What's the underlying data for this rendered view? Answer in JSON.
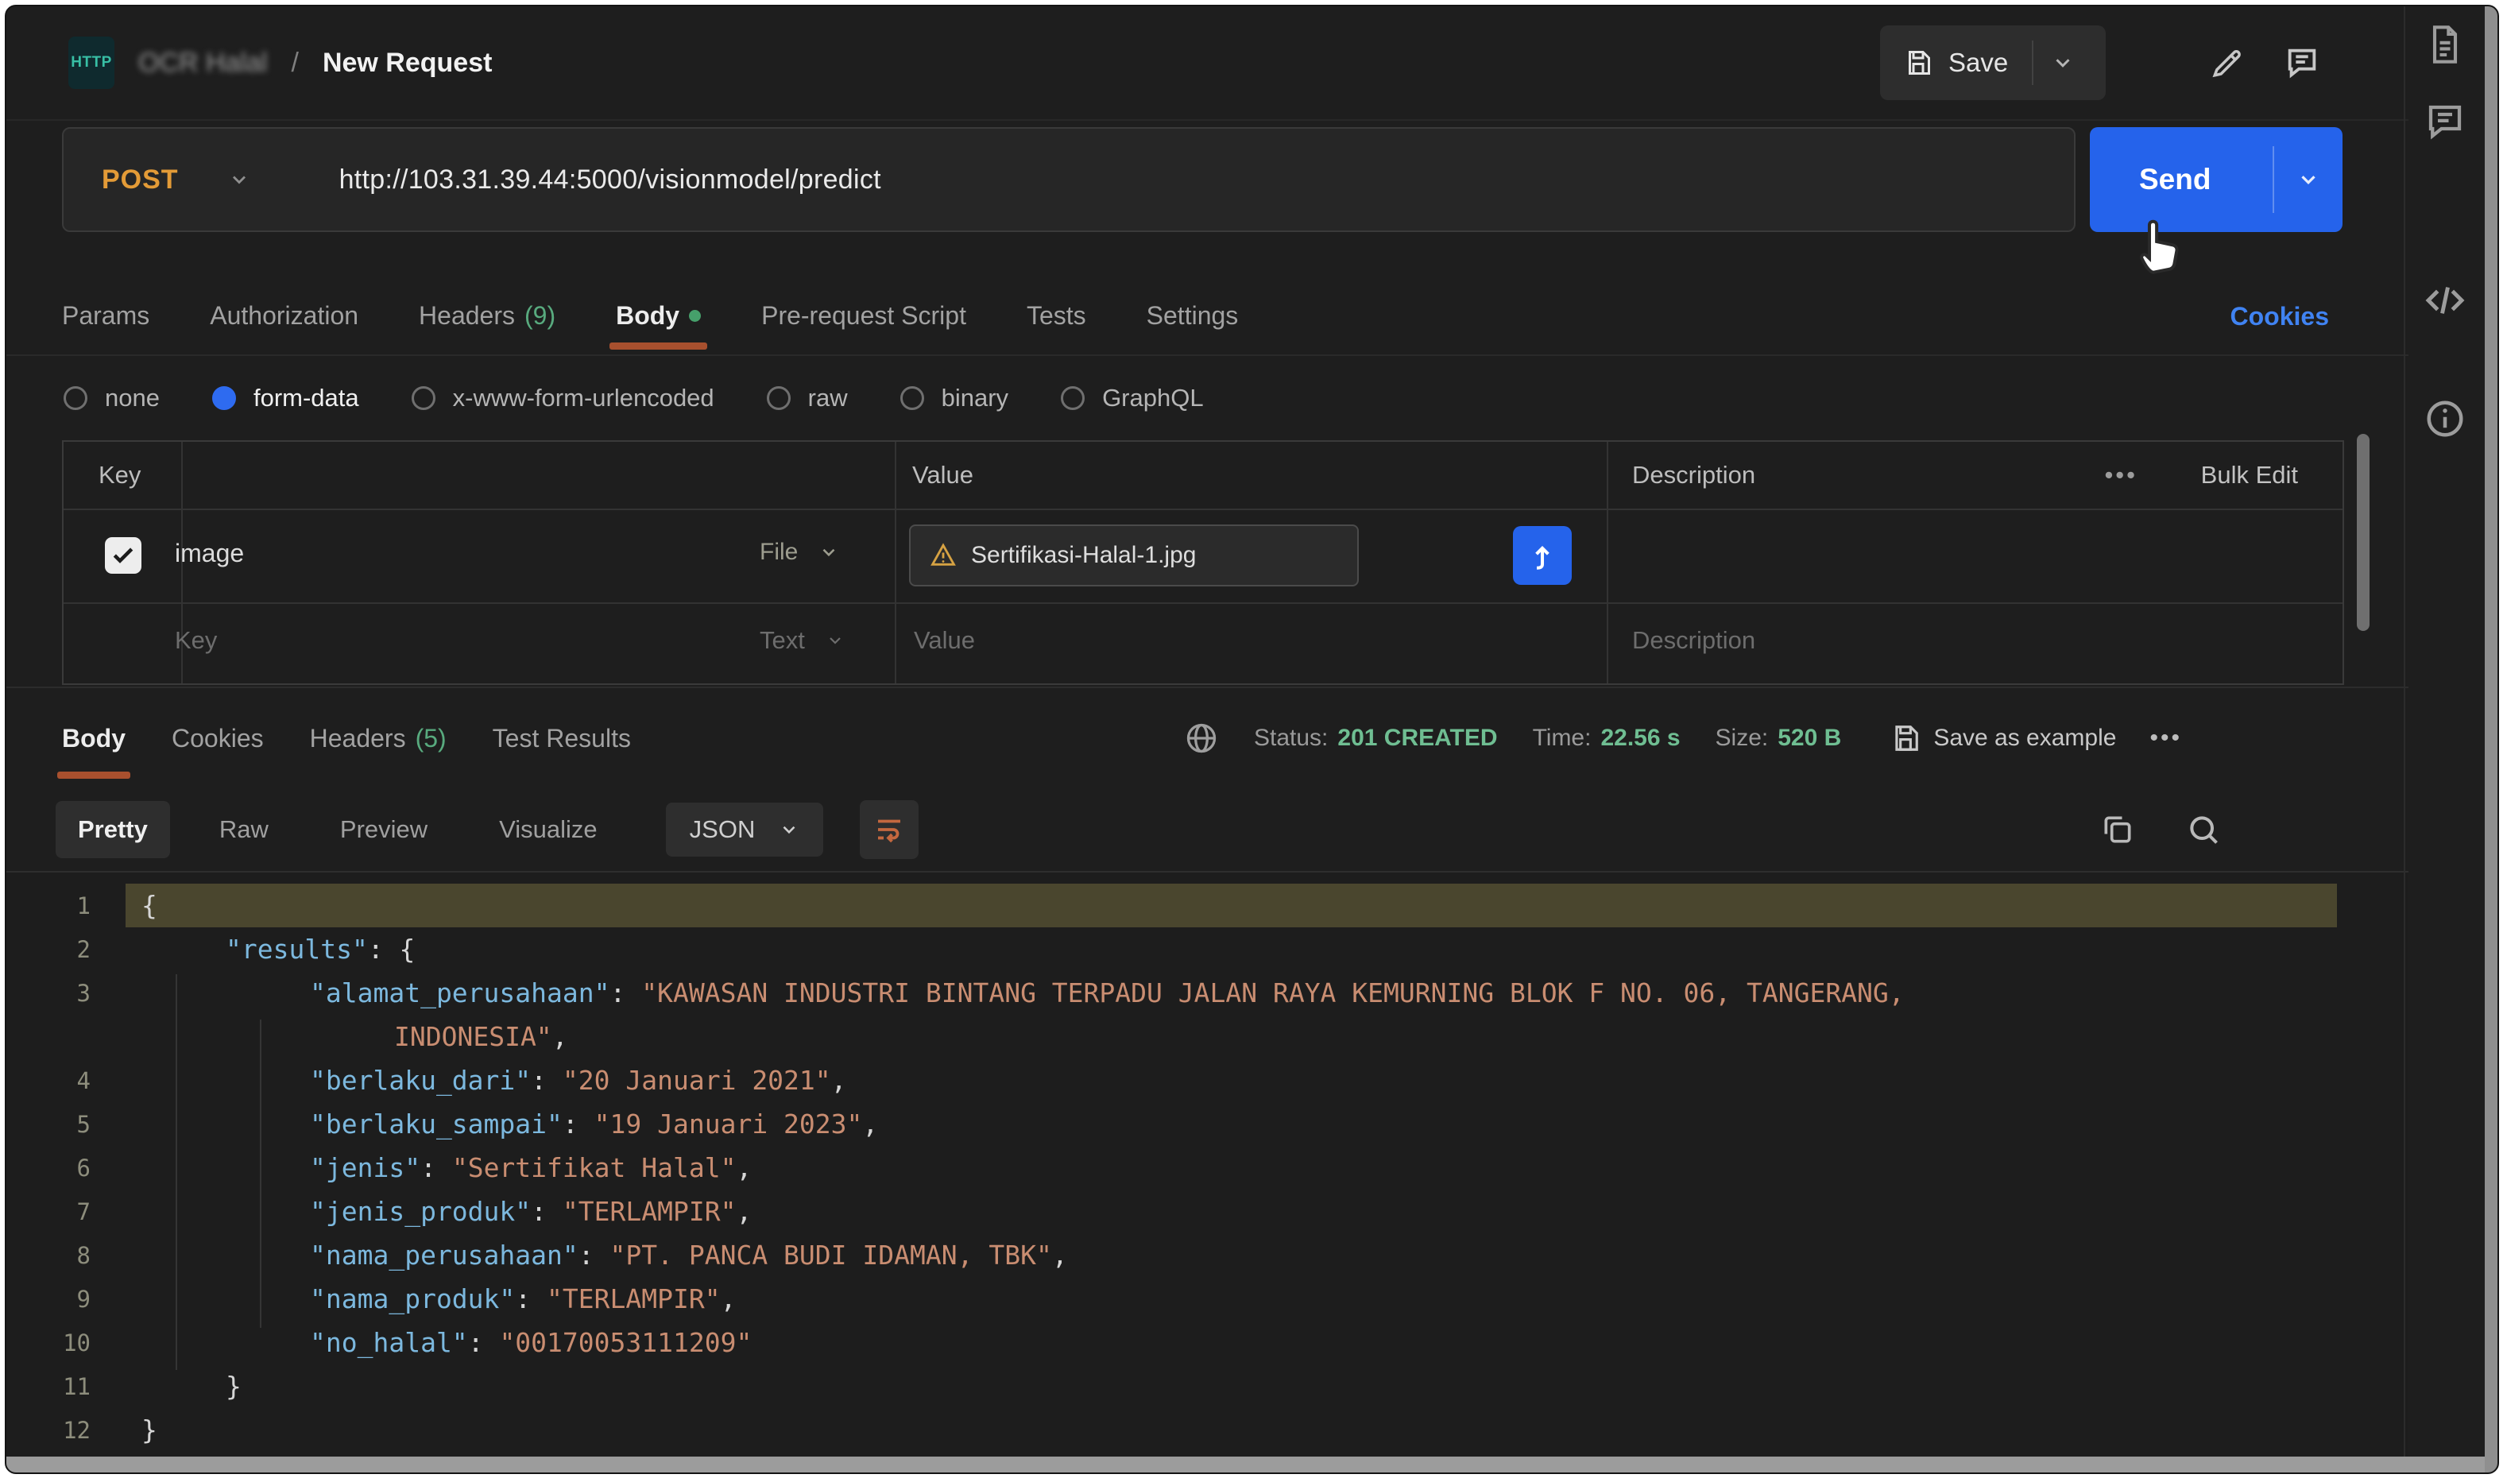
{
  "header": {
    "badge": "HTTP",
    "collection_name": "OCR Halal",
    "separator": "/",
    "request_name": "New Request",
    "save_label": "Save"
  },
  "request_bar": {
    "method": "POST",
    "url": "http://103.31.39.44:5000/visionmodel/predict",
    "send_label": "Send"
  },
  "request_tabs": {
    "items": [
      {
        "label": "Params"
      },
      {
        "label": "Authorization"
      },
      {
        "label": "Headers",
        "count": "(9)"
      },
      {
        "label": "Body",
        "active": true,
        "dot": true
      },
      {
        "label": "Pre-request Script"
      },
      {
        "label": "Tests"
      },
      {
        "label": "Settings"
      }
    ],
    "cookies_link": "Cookies"
  },
  "body_modes": {
    "options": [
      "none",
      "form-data",
      "x-www-form-urlencoded",
      "raw",
      "binary",
      "GraphQL"
    ],
    "selected": "form-data"
  },
  "form_table": {
    "headers": {
      "key": "Key",
      "value": "Value",
      "description": "Description",
      "more": "•••",
      "bulk_edit": "Bulk Edit"
    },
    "row": {
      "checked": true,
      "key": "image",
      "type": "File",
      "file_name": "Sertifikasi-Halal-1.jpg"
    },
    "placeholder_row": {
      "key": "Key",
      "type": "Text",
      "value": "Value",
      "description": "Description"
    }
  },
  "response": {
    "tabs": [
      {
        "label": "Body",
        "active": true
      },
      {
        "label": "Cookies"
      },
      {
        "label": "Headers",
        "count": "(5)"
      },
      {
        "label": "Test Results"
      }
    ],
    "status_label": "Status:",
    "status_value": "201 CREATED",
    "time_label": "Time:",
    "time_value": "22.56 s",
    "size_label": "Size:",
    "size_value": "520 B",
    "save_as_example": "Save as example",
    "more": "•••",
    "view_tabs": [
      {
        "label": "Pretty",
        "active": true
      },
      {
        "label": "Raw"
      },
      {
        "label": "Preview"
      },
      {
        "label": "Visualize"
      }
    ],
    "format_select": "JSON",
    "code": {
      "rows": [
        {
          "num": "1",
          "highlight": true,
          "indent": 0,
          "segs": [
            [
              "p",
              "{"
            ]
          ]
        },
        {
          "num": "2",
          "indent": 1,
          "segs": [
            [
              "k",
              "\"results\""
            ],
            [
              "p",
              ": {"
            ]
          ]
        },
        {
          "num": "3",
          "indent": 2,
          "segs": [
            [
              "k",
              "\"alamat_perusahaan\""
            ],
            [
              "p",
              ": "
            ],
            [
              "s",
              "\"KAWASAN INDUSTRI BINTANG TERPADU JALAN RAYA KEMURNING BLOK F NO. 06, TANGERANG,"
            ]
          ]
        },
        {
          "num": "",
          "indent": 3,
          "segs": [
            [
              "s",
              "INDONESIA\""
            ],
            [
              "p",
              ","
            ]
          ]
        },
        {
          "num": "4",
          "indent": 2,
          "segs": [
            [
              "k",
              "\"berlaku_dari\""
            ],
            [
              "p",
              ": "
            ],
            [
              "s",
              "\"20 Januari 2021\""
            ],
            [
              "p",
              ","
            ]
          ]
        },
        {
          "num": "5",
          "indent": 2,
          "segs": [
            [
              "k",
              "\"berlaku_sampai\""
            ],
            [
              "p",
              ": "
            ],
            [
              "s",
              "\"19 Januari 2023\""
            ],
            [
              "p",
              ","
            ]
          ]
        },
        {
          "num": "6",
          "indent": 2,
          "segs": [
            [
              "k",
              "\"jenis\""
            ],
            [
              "p",
              ": "
            ],
            [
              "s",
              "\"Sertifikat Halal\""
            ],
            [
              "p",
              ","
            ]
          ]
        },
        {
          "num": "7",
          "indent": 2,
          "segs": [
            [
              "k",
              "\"jenis_produk\""
            ],
            [
              "p",
              ": "
            ],
            [
              "s",
              "\"TERLAMPIR\""
            ],
            [
              "p",
              ","
            ]
          ]
        },
        {
          "num": "8",
          "indent": 2,
          "segs": [
            [
              "k",
              "\"nama_perusahaan\""
            ],
            [
              "p",
              ": "
            ],
            [
              "s",
              "\"PT. PANCA BUDI IDAMAN, TBK\""
            ],
            [
              "p",
              ","
            ]
          ]
        },
        {
          "num": "9",
          "indent": 2,
          "segs": [
            [
              "k",
              "\"nama_produk\""
            ],
            [
              "p",
              ": "
            ],
            [
              "s",
              "\"TERLAMPIR\""
            ],
            [
              "p",
              ","
            ]
          ]
        },
        {
          "num": "10",
          "indent": 2,
          "segs": [
            [
              "k",
              "\"no_halal\""
            ],
            [
              "p",
              ": "
            ],
            [
              "s",
              "\"00170053111209\""
            ]
          ]
        },
        {
          "num": "11",
          "indent": 1,
          "segs": [
            [
              "p",
              "}"
            ]
          ]
        },
        {
          "num": "12",
          "indent": 0,
          "segs": [
            [
              "p",
              "}"
            ]
          ]
        }
      ]
    }
  },
  "colors": {
    "method_post": "#e39b37",
    "send_blue": "#2563eb",
    "accent_orange": "#a8502e",
    "status_green": "#6fbe92",
    "link_blue": "#4083f2"
  }
}
